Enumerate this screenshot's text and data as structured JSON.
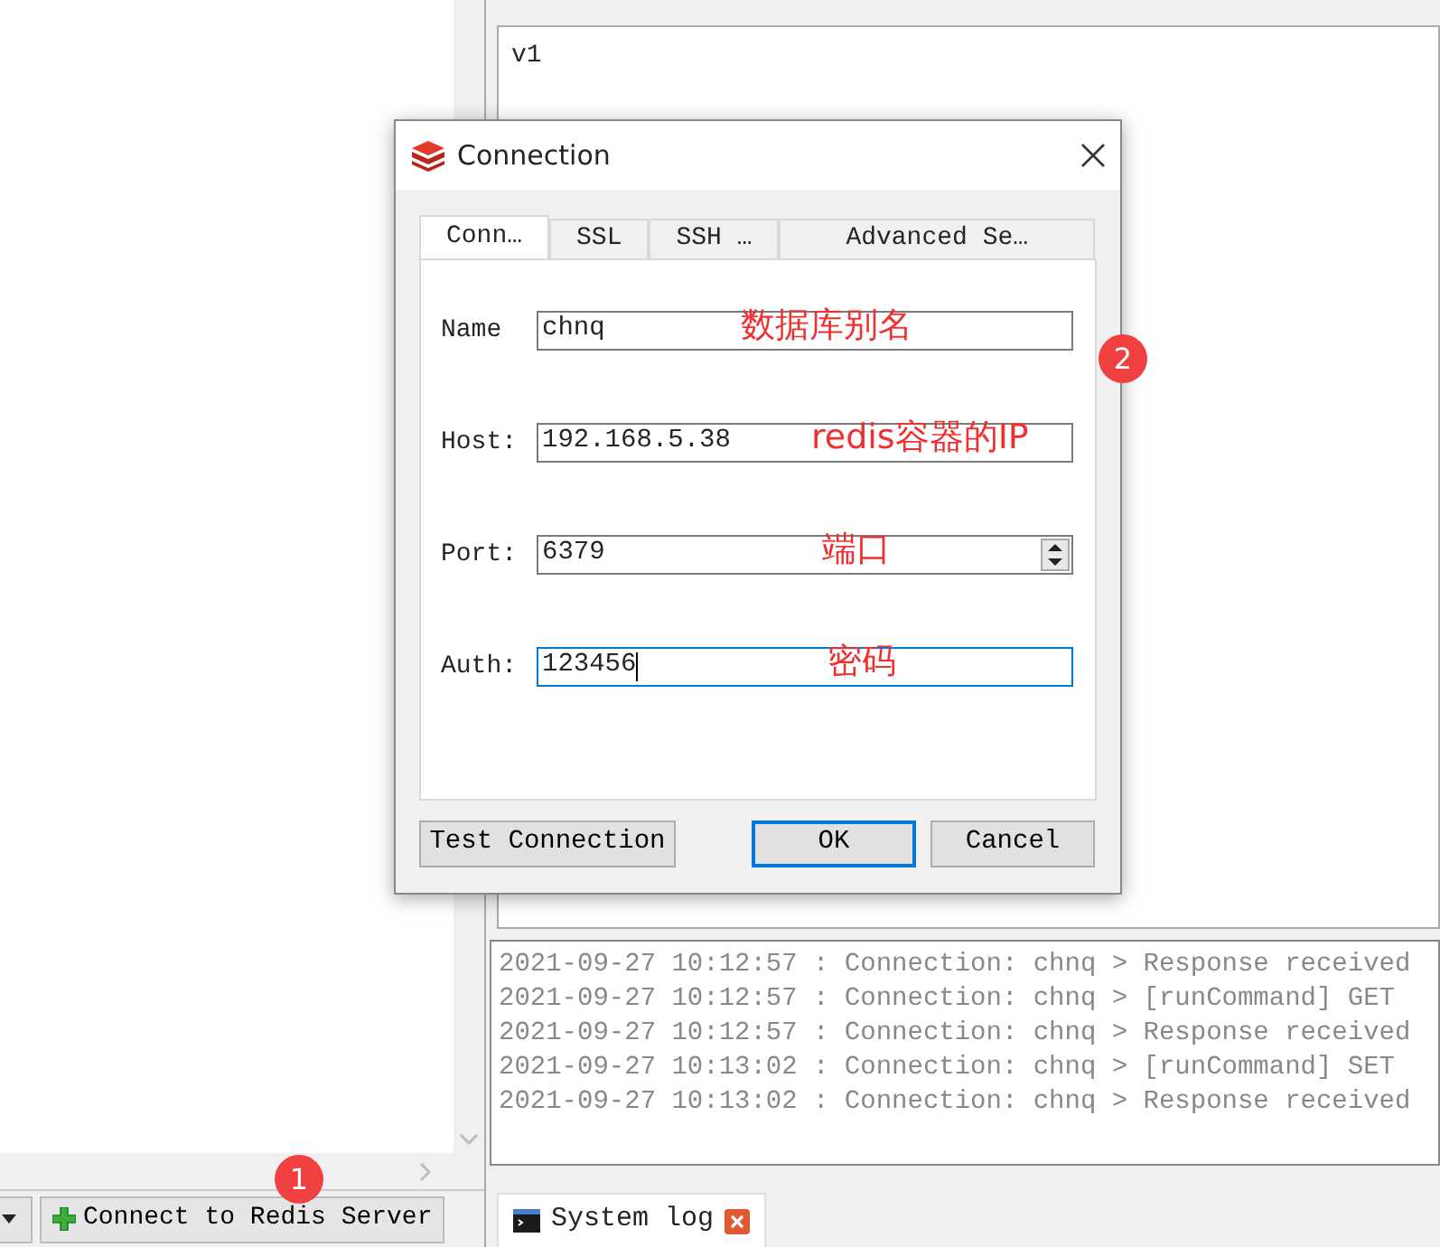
{
  "value_panel": {
    "value_text": "v1"
  },
  "log_lines": [
    "2021-09-27 10:12:57 : Connection: chnq > Response received",
    "2021-09-27 10:12:57 : Connection: chnq > [runCommand] GET",
    "2021-09-27 10:12:57 : Connection: chnq > Response received",
    "2021-09-27 10:13:02 : Connection: chnq > [runCommand] SET",
    "2021-09-27 10:13:02 : Connection: chnq > Response received"
  ],
  "toolbar": {
    "connect_button": "Connect to Redis Server"
  },
  "bottom_tabs": [
    {
      "label": "System log",
      "selected": true
    }
  ],
  "connection_dialog": {
    "title": "Connection",
    "tabs": [
      {
        "label": "Conn…",
        "selected": true
      },
      {
        "label": "SSL",
        "selected": false
      },
      {
        "label": "SSH …",
        "selected": false
      },
      {
        "label": "Advanced Se…",
        "selected": false
      }
    ],
    "fields": [
      {
        "kind": "text",
        "label": "Name",
        "value": "chnq",
        "focused": false,
        "annotation": "数据库别名"
      },
      {
        "kind": "text",
        "label": "Host:",
        "value": "192.168.5.38",
        "focused": false,
        "annotation": "redis容器的IP"
      },
      {
        "kind": "spin",
        "label": "Port:",
        "value": "6379",
        "focused": false,
        "annotation": "端口"
      },
      {
        "kind": "text",
        "label": "Auth:",
        "value": "123456",
        "focused": true,
        "annotation": "密码"
      }
    ],
    "buttons": [
      {
        "label": "Test Connection",
        "default": false
      },
      {
        "label": "OK",
        "default": true
      },
      {
        "label": "Cancel",
        "default": false
      }
    ]
  },
  "callout_badges": [
    "1",
    "2"
  ]
}
